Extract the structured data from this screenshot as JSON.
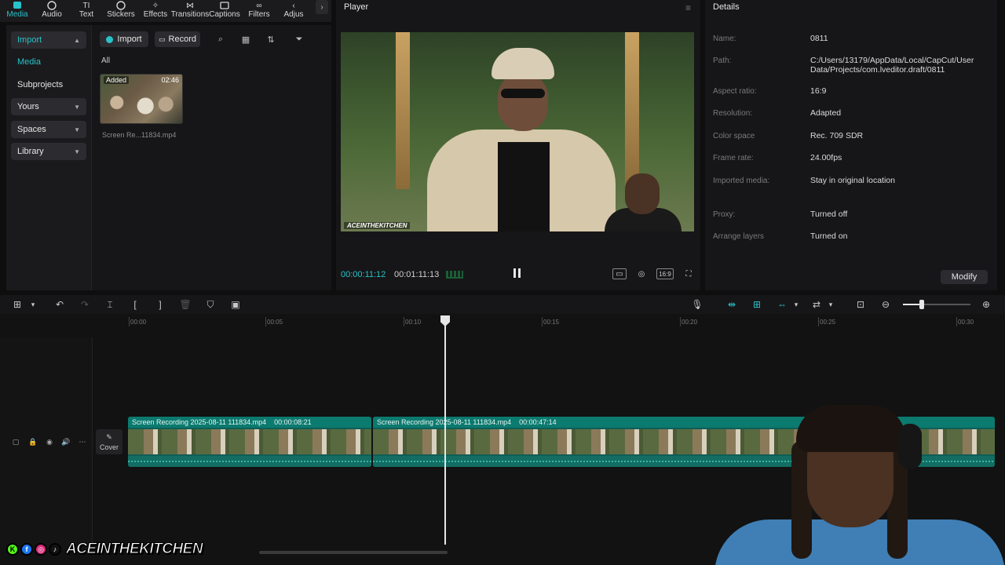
{
  "toolbar": {
    "tabs": [
      {
        "label": "Media",
        "icon": "media-icon",
        "active": true
      },
      {
        "label": "Audio",
        "icon": "audio-icon"
      },
      {
        "label": "Text",
        "icon": "text-icon"
      },
      {
        "label": "Stickers",
        "icon": "stickers-icon"
      },
      {
        "label": "Effects",
        "icon": "effects-icon"
      },
      {
        "label": "Transitions",
        "icon": "transitions-icon"
      },
      {
        "label": "Captions",
        "icon": "captions-icon"
      },
      {
        "label": "Filters",
        "icon": "filters-icon"
      },
      {
        "label": "Adjus",
        "icon": "adjust-icon"
      }
    ]
  },
  "sidebar": {
    "items": [
      {
        "label": "Import"
      },
      {
        "label": "Media"
      },
      {
        "label": "Subprojects"
      },
      {
        "label": "Yours"
      },
      {
        "label": "Spaces"
      },
      {
        "label": "Library"
      }
    ]
  },
  "media": {
    "import_label": "Import",
    "record_label": "Record",
    "filter_label": "All",
    "item": {
      "badge": "Added",
      "duration": "02:46",
      "caption": "Screen Re...11834.mp4"
    }
  },
  "player": {
    "title": "Player",
    "current_time": "00:00:11:12",
    "total_time": "00:01:11:13",
    "ratio_label": "16:9",
    "video_watermark": "ACEINTHEKITCHEN"
  },
  "details": {
    "title": "Details",
    "rows": [
      {
        "key": "Name:",
        "value": "0811"
      },
      {
        "key": "Path:",
        "value": "C:/Users/13179/AppData/Local/CapCut/User Data/Projects/com.lveditor.draft/0811"
      },
      {
        "key": "Aspect ratio:",
        "value": "16:9"
      },
      {
        "key": "Resolution:",
        "value": "Adapted"
      },
      {
        "key": "Color space",
        "value": "Rec. 709 SDR"
      },
      {
        "key": "Frame rate:",
        "value": "24.00fps"
      },
      {
        "key": "Imported media:",
        "value": "Stay in original location"
      },
      {
        "key": "Proxy:",
        "value": "Turned off"
      },
      {
        "key": "Arrange layers",
        "value": "Turned on"
      }
    ],
    "modify_label": "Modify"
  },
  "timeline": {
    "ruler": [
      "00:00",
      "00:05",
      "00:10",
      "00:15",
      "00:20",
      "00:25",
      "00:30"
    ],
    "cover_label": "Cover",
    "clips": [
      {
        "name": "Screen Recording 2025-08-11 111834.mp4",
        "duration": "00:00:08:21"
      },
      {
        "name": "Screen Recording 2025-08-11 111834.mp4",
        "duration": "00:00:47:14"
      }
    ]
  },
  "overlay": {
    "brand_name": "ACEINTHEKITCHEN"
  },
  "colors": {
    "accent": "#27c3c9",
    "clip": "#0b7a6f"
  }
}
